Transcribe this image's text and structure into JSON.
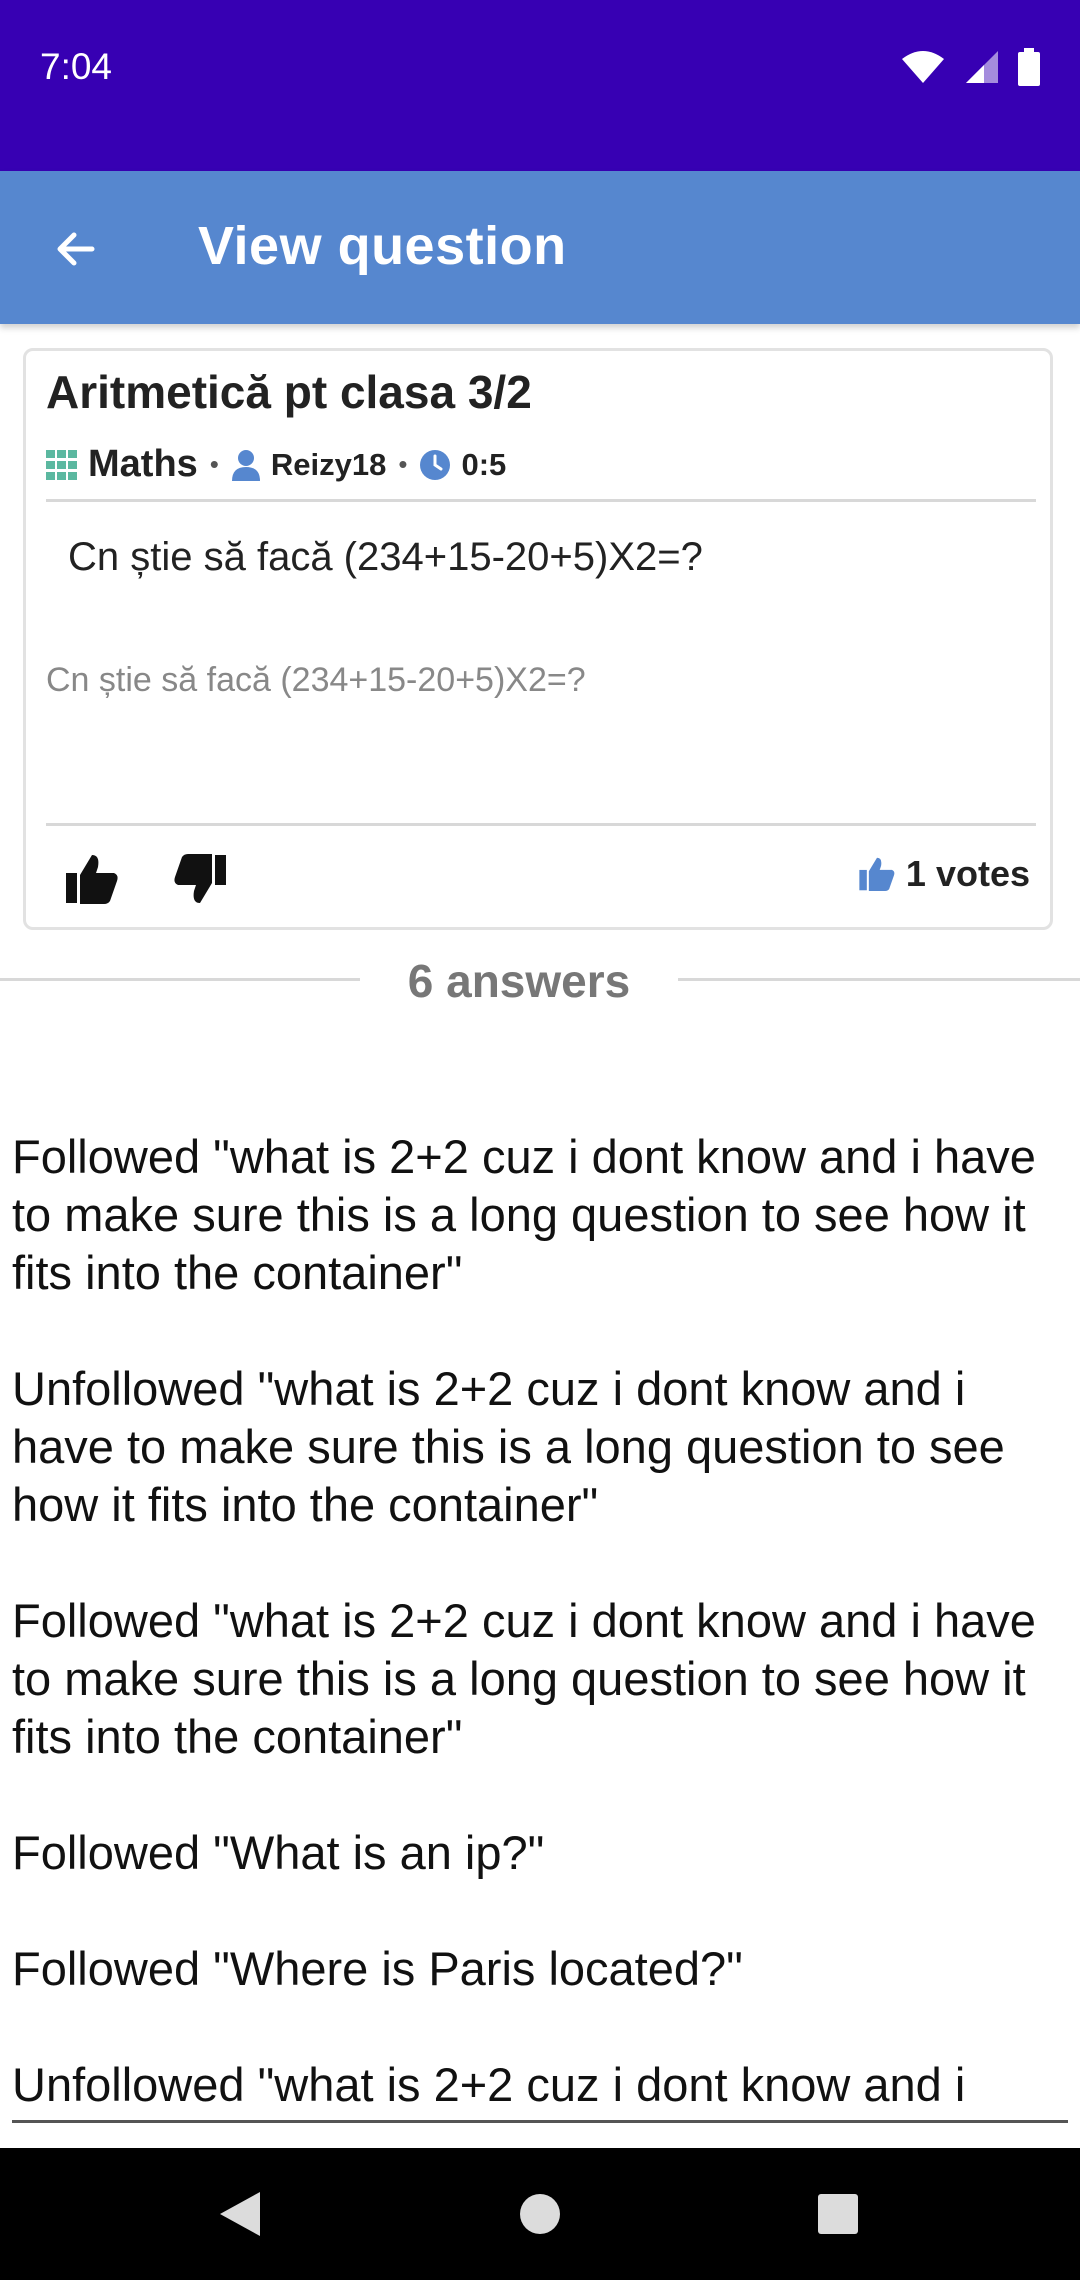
{
  "status_bar": {
    "time": "7:04"
  },
  "app_bar": {
    "title": "View question"
  },
  "question": {
    "title": "Aritmetică pt clasa 3/2",
    "category": "Maths",
    "author": "Reizy18",
    "time": "0:5",
    "body": "Cn știe să facă (234+15-20+5)X2=?",
    "preview": "Cn știe să facă (234+15-20+5)X2=?",
    "votes_label": "1 votes"
  },
  "answers_label": "6 answers",
  "activity": [
    "Followed \"what is 2+2 cuz i dont know and i have to make sure this is a long question to see how it fits into the container\"",
    "Unfollowed \"what is 2+2 cuz i dont know and i have to make sure this is a long question to see how it fits into the container\"",
    "Followed \"what is 2+2 cuz i dont know and i have to make sure this is a long question to see how it fits into the container\"",
    "Followed \"What is an ip?\"",
    "Followed \"Where is Paris located?\"",
    "Unfollowed \"what is 2+2 cuz i dont know and i"
  ],
  "colors": {
    "status_bar": "#3700b3",
    "app_bar": "#5687cf",
    "accent_icon": "#5687cf"
  },
  "icons": {
    "back": "arrow-left-icon",
    "category": "grid-icon",
    "author": "person-icon",
    "time": "clock-icon",
    "vote_up": "thumb-up-icon",
    "vote_down": "thumb-down-icon",
    "votes": "thumb-up-icon",
    "nav_back": "triangle-back-icon",
    "nav_home": "circle-home-icon",
    "nav_recents": "square-recents-icon"
  }
}
